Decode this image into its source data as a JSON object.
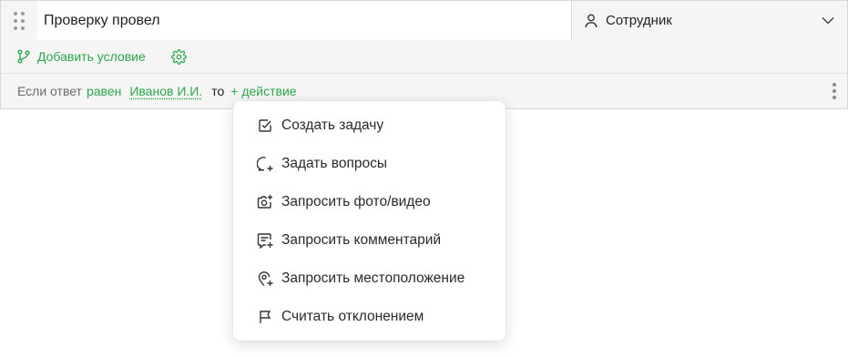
{
  "question": {
    "title": "Проверку провел",
    "answer_type": "Сотрудник"
  },
  "toolbar": {
    "add_condition_label": "Добавить условие"
  },
  "condition": {
    "prefix": "Если ответ",
    "operator": "равен",
    "value": "Иванов И.И.",
    "then": "то",
    "action": "+ действие"
  },
  "menu": {
    "items": [
      {
        "label": "Создать задачу",
        "icon": "checkbox-icon"
      },
      {
        "label": "Задать вопросы",
        "icon": "chat-plus-icon"
      },
      {
        "label": "Запросить фото/видео",
        "icon": "camera-plus-icon"
      },
      {
        "label": "Запросить комментарий",
        "icon": "comment-plus-icon"
      },
      {
        "label": "Запросить местоположение",
        "icon": "location-plus-icon"
      },
      {
        "label": "Считать отклонением",
        "icon": "flag-icon"
      }
    ]
  },
  "colors": {
    "accent_green": "#2aa84a",
    "text": "#1f1f1f",
    "muted": "#6b6b6b"
  }
}
